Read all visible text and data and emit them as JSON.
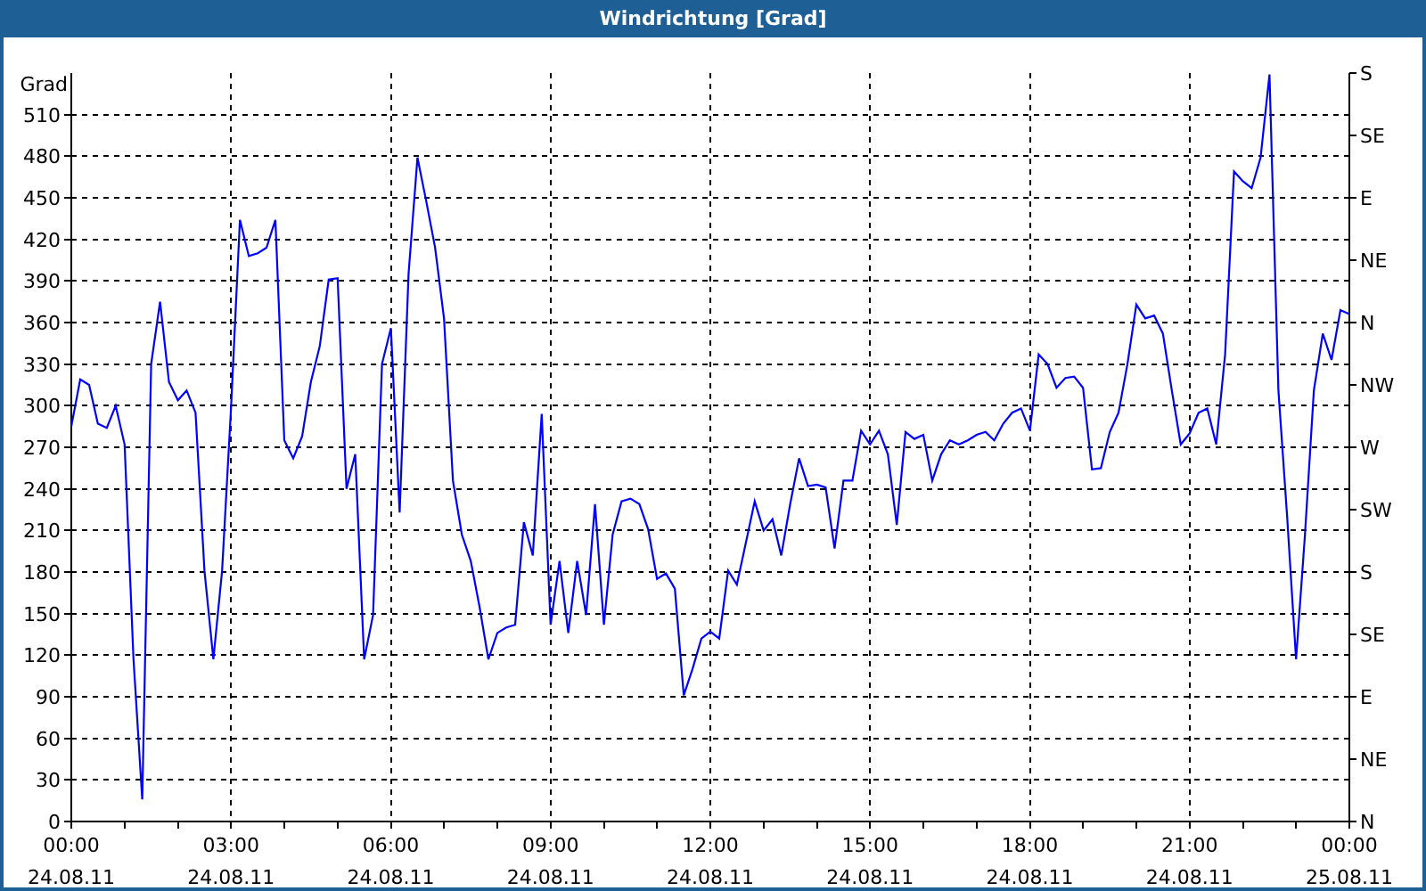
{
  "window": {
    "title": "Windrichtung [Grad]"
  },
  "chart": {
    "right_axis_labels": [
      "S",
      "SE",
      "E",
      "NE",
      "N",
      "NW",
      "W",
      "SW",
      "S",
      "SE",
      "E",
      "NE",
      "N"
    ],
    "chart_data": {
      "type": "line",
      "grid": true,
      "ylabel": "Grad",
      "ylim": [
        0,
        540
      ],
      "yticks": [
        0,
        30,
        60,
        90,
        120,
        150,
        180,
        210,
        240,
        270,
        300,
        330,
        360,
        390,
        420,
        450,
        480,
        510
      ],
      "categories": [
        "00:00 24.08.11",
        null,
        null,
        null,
        null,
        null,
        null,
        null,
        null,
        null,
        null,
        null,
        null,
        null,
        null,
        null,
        null,
        null,
        "03:00 24.08.11",
        null,
        null,
        null,
        null,
        null,
        null,
        null,
        null,
        null,
        null,
        null,
        null,
        null,
        null,
        null,
        null,
        null,
        "06:00 24.08.11",
        null,
        null,
        null,
        null,
        null,
        null,
        null,
        null,
        null,
        null,
        null,
        null,
        null,
        null,
        null,
        null,
        null,
        "09:00 24.08.11",
        null,
        null,
        null,
        null,
        null,
        null,
        null,
        null,
        null,
        null,
        null,
        null,
        null,
        null,
        null,
        null,
        null,
        "12:00 24.08.11",
        null,
        null,
        null,
        null,
        null,
        null,
        null,
        null,
        null,
        null,
        null,
        null,
        null,
        null,
        null,
        null,
        null,
        "15:00 24.08.11",
        null,
        null,
        null,
        null,
        null,
        null,
        null,
        null,
        null,
        null,
        null,
        null,
        null,
        null,
        null,
        null,
        null,
        "18:00 24.08.11",
        null,
        null,
        null,
        null,
        null,
        null,
        null,
        null,
        null,
        null,
        null,
        null,
        null,
        null,
        null,
        null,
        null,
        "21:00 24.08.11",
        null,
        null,
        null,
        null,
        null,
        null,
        null,
        null,
        null,
        null,
        null,
        null,
        null,
        null,
        null,
        null,
        null,
        "00:00 25.08.11"
      ],
      "series": [
        {
          "color": "#0000ff",
          "values": [
            285,
            319,
            315,
            287,
            284,
            300,
            272,
            117,
            16,
            330,
            375,
            317,
            304,
            311,
            295,
            181,
            117,
            181,
            298,
            434,
            408,
            410,
            414,
            434,
            275,
            262,
            278,
            317,
            343,
            391,
            392,
            240,
            265,
            117,
            149,
            330,
            356,
            223,
            395,
            479,
            447,
            414,
            363,
            246,
            207,
            188,
            155,
            117,
            136,
            140,
            142,
            216,
            192,
            294,
            142,
            188,
            136,
            188,
            149,
            229,
            142,
            207,
            231,
            233,
            229,
            211,
            175,
            179,
            168,
            91,
            110,
            132,
            137,
            132,
            181,
            171,
            201,
            231,
            210,
            218,
            192,
            229,
            262,
            242,
            243,
            241,
            197,
            246,
            246,
            282,
            272,
            282,
            265,
            214,
            281,
            276,
            279,
            246,
            265,
            275,
            272,
            275,
            279,
            281,
            275,
            287,
            295,
            298,
            282,
            337,
            330,
            313,
            320,
            321,
            313,
            254,
            255,
            281,
            295,
            330,
            373,
            363,
            365,
            352,
            311,
            272,
            280,
            295,
            298,
            272,
            337,
            469,
            462,
            457,
            479,
            539,
            311,
            220,
            117,
            207,
            311,
            352,
            333,
            369,
            366
          ]
        }
      ]
    }
  }
}
